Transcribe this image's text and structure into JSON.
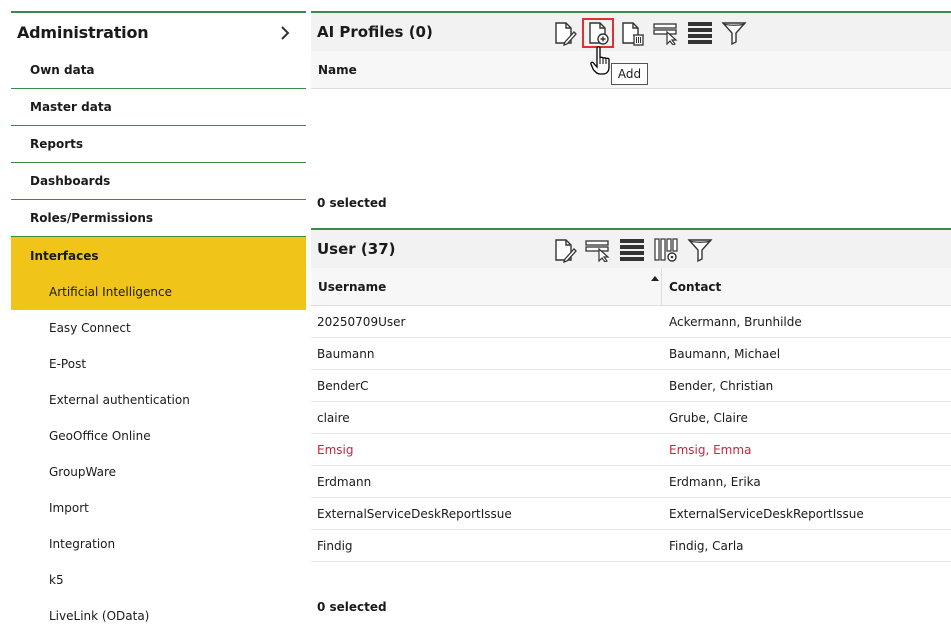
{
  "sidebar": {
    "title": "Administration",
    "items": [
      {
        "label": "Own data"
      },
      {
        "label": "Master data"
      },
      {
        "label": "Reports"
      },
      {
        "label": "Dashboards"
      },
      {
        "label": "Roles/Permissions"
      },
      {
        "label": "Interfaces"
      }
    ],
    "subitems": [
      {
        "label": "Artificial Intelligence"
      },
      {
        "label": "Easy Connect"
      },
      {
        "label": "E-Post"
      },
      {
        "label": "External authentication"
      },
      {
        "label": "GeoOffice Online"
      },
      {
        "label": "GroupWare"
      },
      {
        "label": "Import"
      },
      {
        "label": "Integration"
      },
      {
        "label": "k5"
      },
      {
        "label": "LiveLink (OData)"
      }
    ]
  },
  "ai_profiles": {
    "title": "AI Profiles (0)",
    "columns": [
      "Name"
    ],
    "footer": "0 selected",
    "toolbar": [
      "edit-icon",
      "add-icon",
      "delete-icon",
      "select-icon",
      "list-icon",
      "filter-icon"
    ],
    "tooltip": "Add"
  },
  "users": {
    "title": "User (37)",
    "columns": [
      "Username",
      "Contact"
    ],
    "rows": [
      {
        "username": "20250709User",
        "contact": "Ackermann, Brunhilde"
      },
      {
        "username": "Baumann",
        "contact": "Baumann, Michael"
      },
      {
        "username": "BenderC",
        "contact": "Bender, Christian"
      },
      {
        "username": "claire",
        "contact": "Grube, Claire"
      },
      {
        "username": "Emsig",
        "contact": "Emsig, Emma",
        "highlight": "#c4283a"
      },
      {
        "username": "Erdmann",
        "contact": "Erdmann, Erika"
      },
      {
        "username": "ExternalServiceDeskReportIssue",
        "contact": "ExternalServiceDeskReportIssue"
      },
      {
        "username": "Findig",
        "contact": "Findig, Carla"
      }
    ],
    "footer": "0 selected",
    "toolbar": [
      "edit-icon",
      "select-icon",
      "list-icon",
      "columns-settings-icon",
      "filter-icon"
    ]
  },
  "colors": {
    "accent_green": "#3a8a4a",
    "active_yellow": "#f0c419",
    "highlight_red": "#c4283a"
  }
}
